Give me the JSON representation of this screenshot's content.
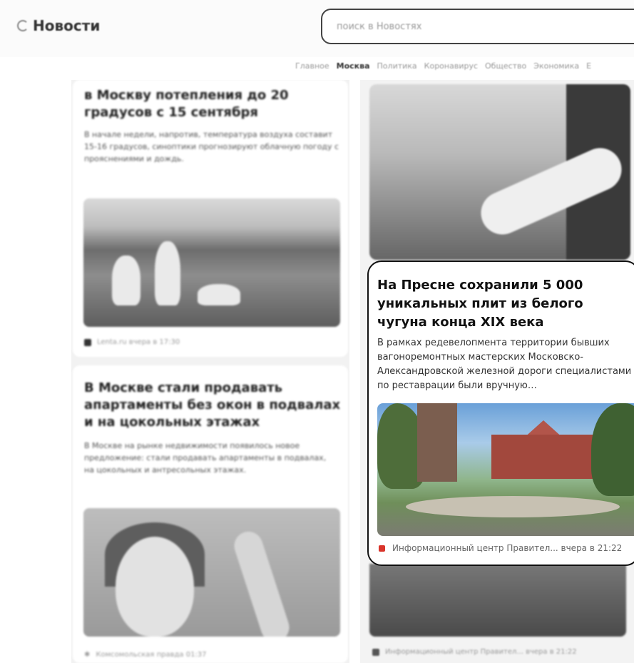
{
  "header": {
    "app_name": "Новости",
    "search_placeholder": "поиск в Новостях"
  },
  "nav": {
    "items": [
      "Главное",
      "Москва",
      "Политика",
      "Коронавирус",
      "Общество",
      "Экономика",
      "Е"
    ],
    "active_index": 1
  },
  "feed": {
    "left": [
      {
        "title": "в Москву потепления до 20 градусов с 15 сентября",
        "description": "В начале недели, напротив, температура воздуха составит 15-16 градусов, синоптики прогнозируют облачную погоду с прояснениями и дождь.",
        "source": "Lenta.ru вчера в 17:30"
      },
      {
        "title": "В Москве стали продавать апартаменты без окон в подвалах и на цокольных этажах",
        "description": "В Москве на рынке недвижимости появилось новое предложение: стали продавать апартаменты в подвалах, на цокольных и антресольных этажах.",
        "source": "Комсомольская правда 01:37"
      }
    ],
    "highlighted": {
      "title": "На Пресне сохранили 5 000 уникальных плит из белого чугуна конца XIX века",
      "description": "В рамках редевелопмента территории бывших вагоноремонтных мастерских Московско-Александровской железной дороги специалистами по реставрации были вручную…",
      "source": "Информационный центр Правител... вчера в 21:22"
    },
    "bottom_source": "Информационный центр Правител... вчера в 21:22"
  },
  "colors": {
    "source_icon_red": "#d9342b",
    "highlight_border": "#111111"
  }
}
